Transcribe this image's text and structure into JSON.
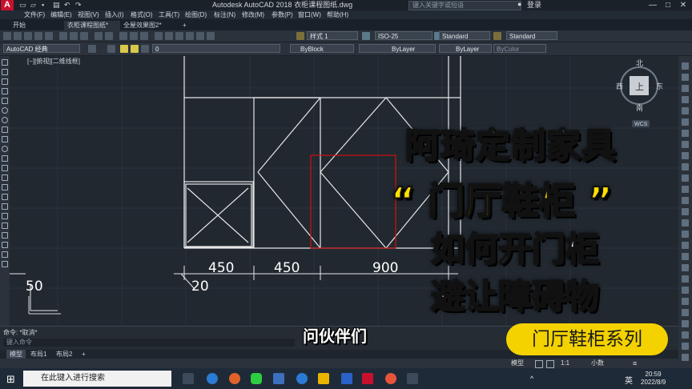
{
  "titlebar": {
    "app_title": "Autodesk AutoCAD 2018    衣柜课程图纸.dwg",
    "search_placeholder": "键入关键字或短语",
    "login_label": "登录",
    "logo_letter": "A",
    "minimize": "—",
    "maximize": "□",
    "close": "✕"
  },
  "menubar": {
    "items": [
      "文件(F)",
      "编辑(E)",
      "视图(V)",
      "插入(I)",
      "格式(O)",
      "工具(T)",
      "绘图(D)",
      "标注(N)",
      "修改(M)",
      "参数(P)",
      "窗口(W)",
      "帮助(H)"
    ]
  },
  "tabs": {
    "items": [
      "开始",
      "衣柜课程图纸*",
      "全屋效果图2*"
    ],
    "add": "+"
  },
  "toolbar": {
    "text_style": "样式 1",
    "dim_style": "ISO-25",
    "table_style": "Standard",
    "multileader_style": "Standard",
    "workspace": "AutoCAD 经典",
    "layer": "0",
    "color": "ByBlock",
    "linetype": "ByLayer",
    "lineweight": "ByLayer",
    "plotstyle": "ByColor"
  },
  "viewport": {
    "label": "[−][俯视][二维线框]",
    "viewcube": {
      "north": "北",
      "south": "南",
      "east": "东",
      "west": "西",
      "top": "上",
      "wcs": "WCS"
    }
  },
  "drawing": {
    "dims": [
      "450",
      "450",
      "900",
      "20",
      "50"
    ]
  },
  "command": {
    "history": "命令: *取消*",
    "prompt": "键入命令"
  },
  "layout_tabs": {
    "items": [
      "模型",
      "布局1",
      "布局2"
    ],
    "add": "+"
  },
  "status": {
    "model": "模型",
    "scale": "1:1",
    "units": "小数"
  },
  "overlay": {
    "line1": "阿琦定制家具",
    "line2": "“  门厅鞋柜  ”",
    "line3": "如何开门柜",
    "line4": "避让障碍物",
    "subtitle": "问伙伴们",
    "series_badge": "门厅鞋柜系列"
  },
  "taskbar": {
    "search_placeholder": "在此键入进行搜索",
    "ime": "英",
    "time": "20:59",
    "date": "2022/8/9"
  },
  "colors": {
    "canvas": "#212830",
    "accent_red": "#c8102e",
    "badge_yellow": "#f3d200",
    "title_yellow": "#ffe100"
  }
}
